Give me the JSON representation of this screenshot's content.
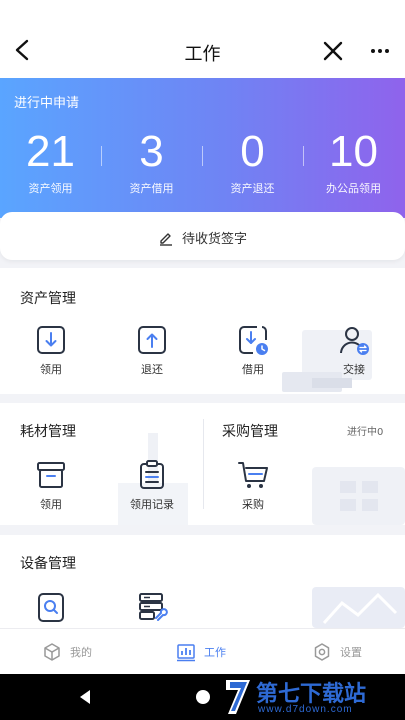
{
  "header": {
    "title": "工作"
  },
  "summary": {
    "title": "进行中申请",
    "stats": [
      {
        "value": "21",
        "label": "资产领用"
      },
      {
        "value": "3",
        "label": "资产借用"
      },
      {
        "value": "0",
        "label": "资产退还"
      },
      {
        "value": "10",
        "label": "办公品领用"
      }
    ],
    "sign_label": "待收货签字"
  },
  "asset_management": {
    "title": "资产管理",
    "items": [
      {
        "label": "领用",
        "icon": "download-box-icon"
      },
      {
        "label": "退还",
        "icon": "upload-box-icon"
      },
      {
        "label": "借用",
        "icon": "borrow-clock-icon"
      },
      {
        "label": "交接",
        "icon": "user-transfer-icon"
      }
    ]
  },
  "consumables": {
    "title": "耗材管理",
    "items": [
      {
        "label": "领用",
        "icon": "archive-box-icon"
      },
      {
        "label": "领用记录",
        "icon": "clipboard-list-icon"
      }
    ]
  },
  "procurement": {
    "title": "采购管理",
    "status": "进行中0",
    "items": [
      {
        "label": "采购",
        "icon": "shopping-cart-icon"
      }
    ]
  },
  "equipment": {
    "title": "设备管理",
    "items": [
      {
        "label": "",
        "icon": "search-document-icon"
      },
      {
        "label": "",
        "icon": "server-wrench-icon"
      }
    ]
  },
  "tabs": [
    {
      "label": "我的",
      "icon": "cube-icon",
      "active": false
    },
    {
      "label": "工作",
      "icon": "bar-chart-icon",
      "active": true
    },
    {
      "label": "设置",
      "icon": "settings-icon",
      "active": false
    }
  ],
  "watermark": {
    "text": "第七下载站",
    "url": "www.d7down.com"
  },
  "colors": {
    "accent": "#4a7ff0",
    "hero_start": "#5aa5ff",
    "hero_end": "#8f63ec",
    "icon_stroke": "#2b3444",
    "icon_blue": "#4a7ff0"
  }
}
